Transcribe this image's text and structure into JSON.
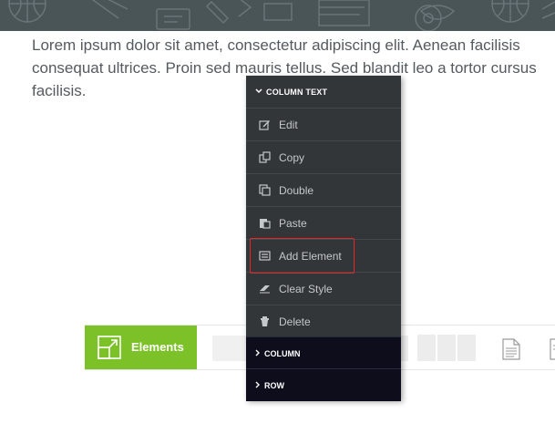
{
  "paragraph": {
    "text": "Lorem ipsum dolor sit amet, consectetur adipiscing elit. Aenean facilisis consequat ultrices. Proin sed mauris tellus. Sed blandit leo a tortor cursus facilisis."
  },
  "toolbar": {
    "elements_label": "Elements"
  },
  "context_menu": {
    "header": "COLUMN TEXT",
    "items": [
      {
        "label": "Edit",
        "icon": "edit-icon"
      },
      {
        "label": "Copy",
        "icon": "copy-icon"
      },
      {
        "label": "Double",
        "icon": "double-icon"
      },
      {
        "label": "Paste",
        "icon": "paste-icon"
      },
      {
        "label": "Add Element",
        "icon": "add-element-icon"
      },
      {
        "label": "Clear Style",
        "icon": "eraser-icon"
      },
      {
        "label": "Delete",
        "icon": "trash-icon"
      }
    ],
    "sections": [
      {
        "label": "COLUMN"
      },
      {
        "label": "ROW"
      }
    ],
    "highlighted_item": "Add Element"
  },
  "colors": {
    "accent_green": "#7cc128",
    "menu_bg": "#333639",
    "section_bg": "#0d0d1c",
    "highlight_red": "#e02a2a",
    "banner_bg": "#4a5558"
  }
}
